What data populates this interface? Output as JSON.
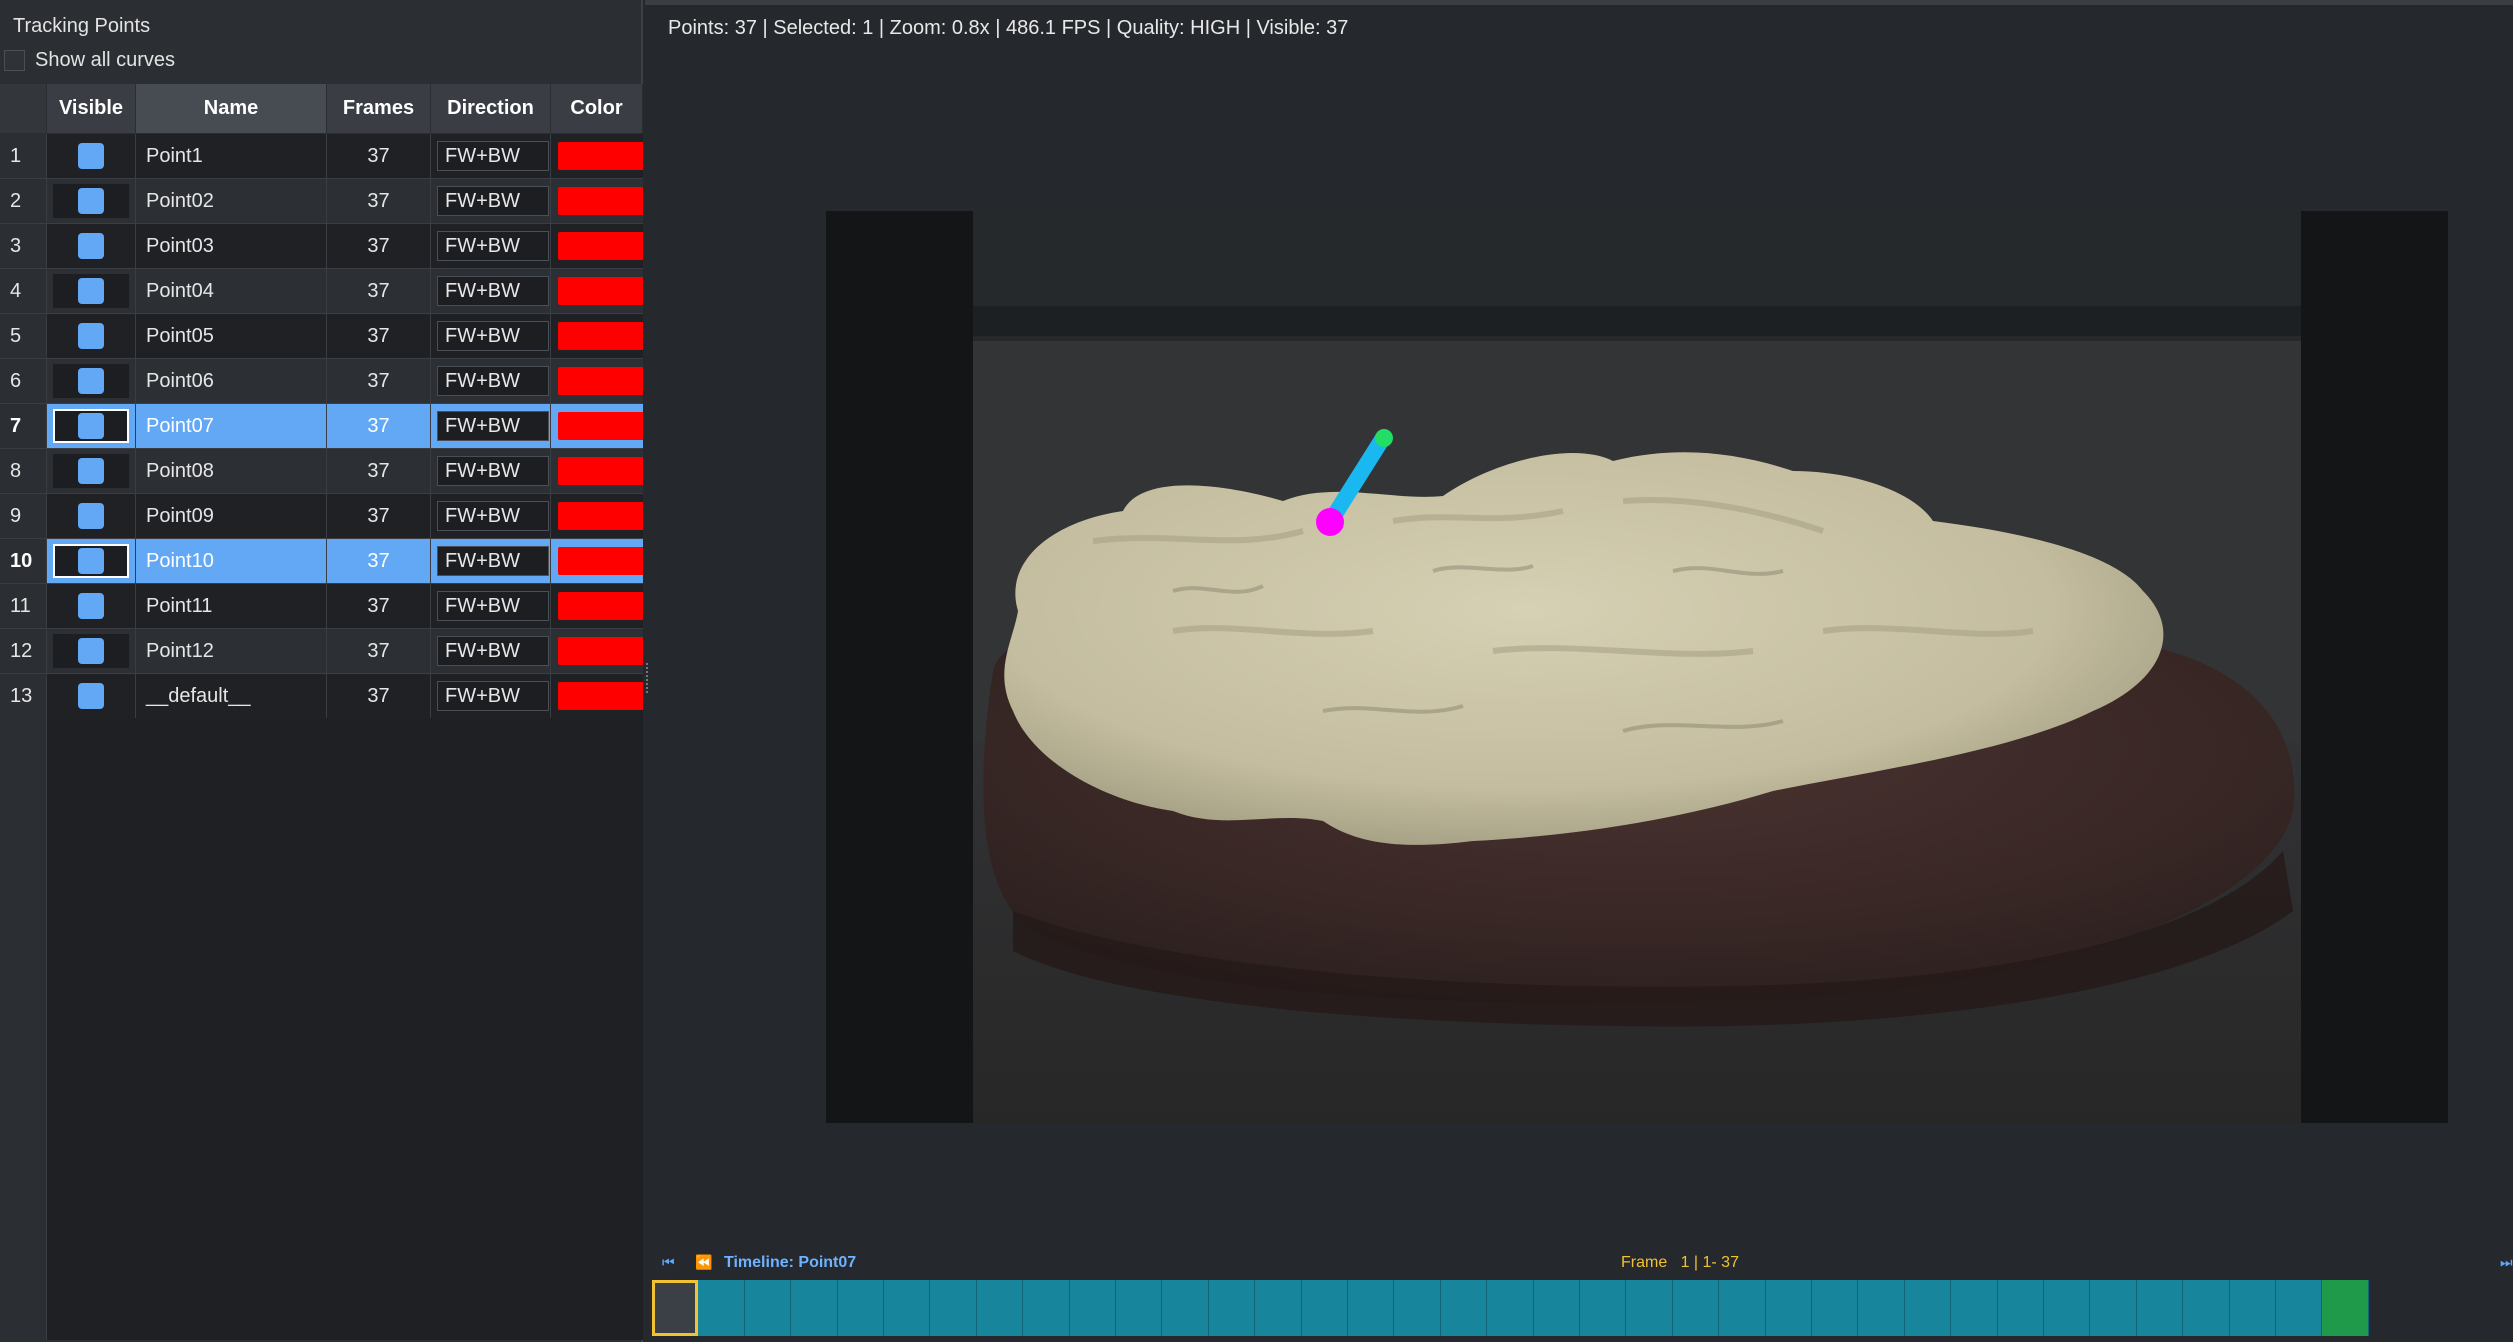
{
  "panel": {
    "title": "Tracking Points",
    "show_all_curves_label": "Show all curves",
    "show_all_curves_checked": false
  },
  "table": {
    "headers": [
      "Visible",
      "Name",
      "Frames",
      "Direction",
      "Color"
    ],
    "rows": [
      {
        "num": "1",
        "name": "Point1",
        "frames": "37",
        "direction": "FW+BW",
        "color": "#ff0000",
        "selected": false
      },
      {
        "num": "2",
        "name": "Point02",
        "frames": "37",
        "direction": "FW+BW",
        "color": "#ff0000",
        "selected": false
      },
      {
        "num": "3",
        "name": "Point03",
        "frames": "37",
        "direction": "FW+BW",
        "color": "#ff0000",
        "selected": false
      },
      {
        "num": "4",
        "name": "Point04",
        "frames": "37",
        "direction": "FW+BW",
        "color": "#ff0000",
        "selected": false
      },
      {
        "num": "5",
        "name": "Point05",
        "frames": "37",
        "direction": "FW+BW",
        "color": "#ff0000",
        "selected": false
      },
      {
        "num": "6",
        "name": "Point06",
        "frames": "37",
        "direction": "FW+BW",
        "color": "#ff0000",
        "selected": false
      },
      {
        "num": "7",
        "name": "Point07",
        "frames": "37",
        "direction": "FW+BW",
        "color": "#ff0000",
        "selected": true
      },
      {
        "num": "8",
        "name": "Point08",
        "frames": "37",
        "direction": "FW+BW",
        "color": "#ff0000",
        "selected": false
      },
      {
        "num": "9",
        "name": "Point09",
        "frames": "37",
        "direction": "FW+BW",
        "color": "#ff0000",
        "selected": false
      },
      {
        "num": "10",
        "name": "Point10",
        "frames": "37",
        "direction": "FW+BW",
        "color": "#ff0000",
        "selected": true
      },
      {
        "num": "11",
        "name": "Point11",
        "frames": "37",
        "direction": "FW+BW",
        "color": "#ff0000",
        "selected": false
      },
      {
        "num": "12",
        "name": "Point12",
        "frames": "37",
        "direction": "FW+BW",
        "color": "#ff0000",
        "selected": false
      },
      {
        "num": "13",
        "name": "__default__",
        "frames": "37",
        "direction": "FW+BW",
        "color": "#ff0000",
        "selected": false
      }
    ]
  },
  "status_bar": {
    "text": "Points: 37 | Selected: 1 | Zoom: 0.8x | 486.1 FPS | Quality: HIGH | Visible: 37"
  },
  "viewer": {
    "track_colors": {
      "start": "#ff00ff",
      "path": "#1ab8f0",
      "end": "#22dd66"
    }
  },
  "timeline": {
    "label": "Timeline: Point07",
    "frame_text": "Frame   1 | 1- 37",
    "total_frames": 37,
    "current_frame": 1,
    "icons": [
      "jump-to-start-icon",
      "step-back-icon",
      "jump-to-end-icon"
    ],
    "colors": {
      "frame": "#17859c",
      "current": "#f1c232",
      "keyframe": "#1f9a4a"
    }
  }
}
